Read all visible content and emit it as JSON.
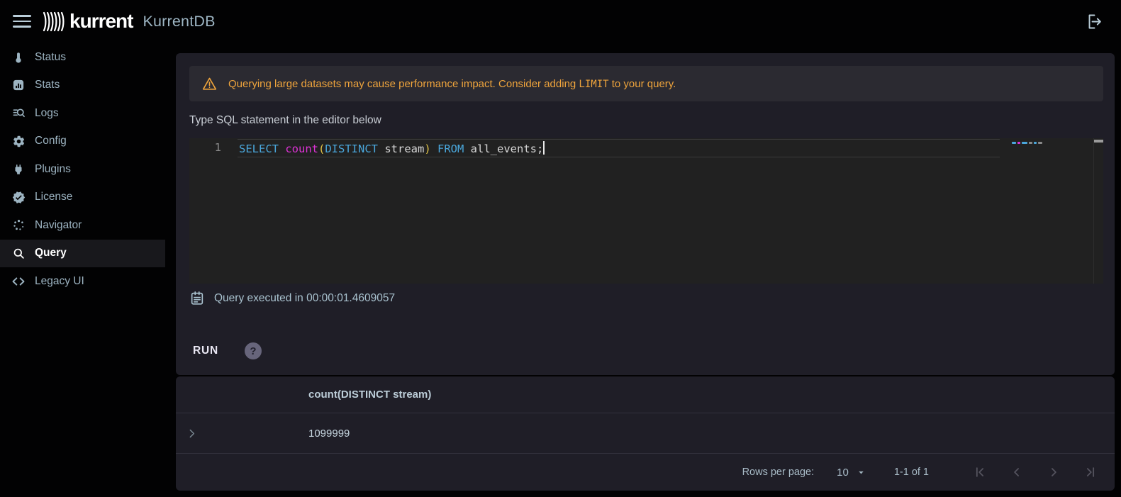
{
  "topbar": {
    "brand": "kurrent",
    "product": "KurrentDB"
  },
  "sidebar": {
    "items": [
      {
        "label": "Status"
      },
      {
        "label": "Stats"
      },
      {
        "label": "Logs"
      },
      {
        "label": "Config"
      },
      {
        "label": "Plugins"
      },
      {
        "label": "License"
      },
      {
        "label": "Navigator"
      },
      {
        "label": "Query",
        "active": true
      },
      {
        "label": "Legacy UI"
      }
    ]
  },
  "query_panel": {
    "warning": {
      "text_before_code": "Querying large datasets may cause performance impact. Consider adding ",
      "code": "LIMIT",
      "text_after_code": " to your query."
    },
    "editor_hint": "Type SQL statement in the editor below",
    "editor": {
      "line_number": "1",
      "tokens": [
        {
          "text": "SELECT ",
          "type": "keyword"
        },
        {
          "text": "count",
          "type": "function"
        },
        {
          "text": "(",
          "type": "bracket"
        },
        {
          "text": "DISTINCT",
          "type": "keyword"
        },
        {
          "text": " stream",
          "type": "plain"
        },
        {
          "text": ")",
          "type": "bracket"
        },
        {
          "text": " ",
          "type": "plain"
        },
        {
          "text": "FROM",
          "type": "keyword"
        },
        {
          "text": " all_events;",
          "type": "plain"
        }
      ]
    },
    "execution_status": "Query executed in 00:00:01.4609057",
    "run_label": "RUN",
    "help_glyph": "?"
  },
  "results_panel": {
    "columns": [
      "count(DISTINCT stream)"
    ],
    "rows": [
      {
        "value": "1099999"
      }
    ],
    "pagination": {
      "rows_per_page_label": "Rows per page:",
      "rows_per_page_value": "10",
      "range_label": "1-1 of 1"
    }
  },
  "colors": {
    "warning_accent": "#efa43c",
    "code_keyword": "#4aa7dc",
    "code_function": "#de33d6",
    "code_bracket": "#dfc247",
    "code_plain": "#d5d5d5",
    "panel_bg": "#1f1e27",
    "editor_bg": "#212121",
    "sidebar_text": "#9db4c2",
    "active_item_bg": "#18181c"
  }
}
